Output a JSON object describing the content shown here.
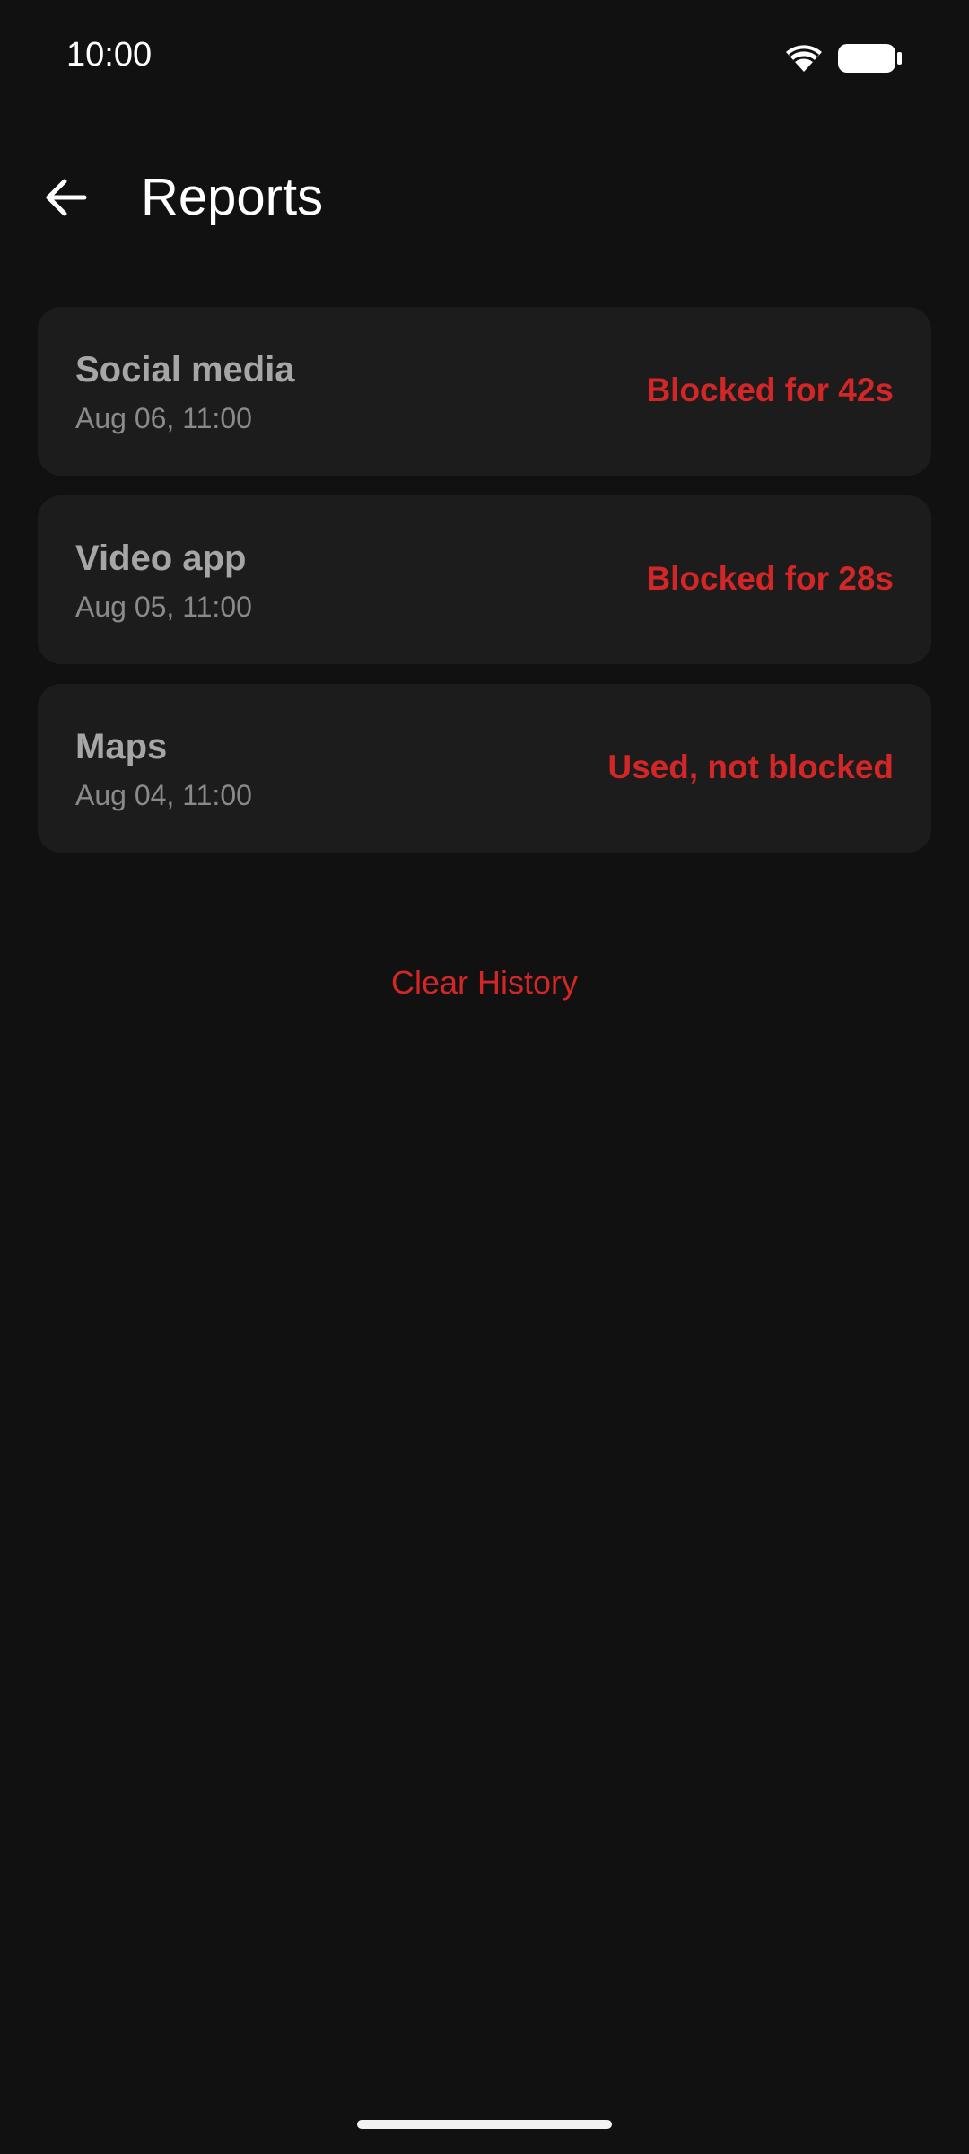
{
  "status_bar": {
    "time": "10:00",
    "icons": [
      "wifi-icon",
      "battery-icon"
    ]
  },
  "header": {
    "back_icon": "arrow-back-icon",
    "title": "Reports"
  },
  "reports": [
    {
      "app": "Social media",
      "date": "Aug 06, 11:00",
      "status": "Blocked for 42s"
    },
    {
      "app": "Video app",
      "date": "Aug 05, 11:00",
      "status": "Blocked for 28s"
    },
    {
      "app": "Maps",
      "date": "Aug 04, 11:00",
      "status": "Used, not blocked"
    }
  ],
  "clear_history_label": "Clear History",
  "colors": {
    "background": "#111111",
    "card": "#1c1c1c",
    "accent_red": "#d32626",
    "title_gray": "#a6a6a6",
    "date_gray": "#8a8a8a"
  }
}
